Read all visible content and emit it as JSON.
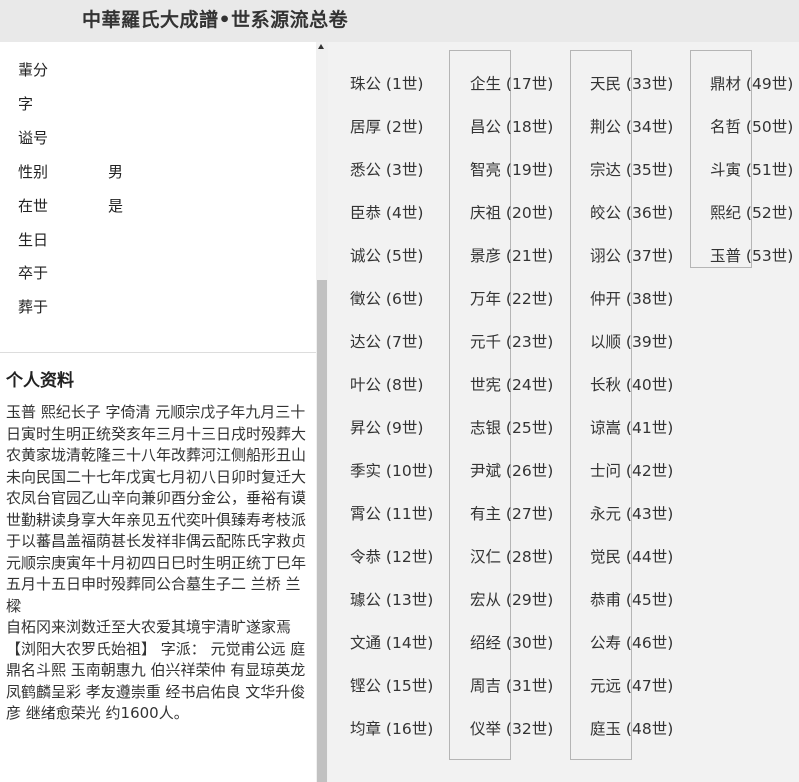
{
  "header": {
    "title": "中華羅氏大成譜•世系源流总卷"
  },
  "info_fields": [
    {
      "label": "輩分",
      "value": ""
    },
    {
      "label": "字",
      "value": ""
    },
    {
      "label": "谥号",
      "value": ""
    },
    {
      "label": "性别",
      "value": "男"
    },
    {
      "label": "在世",
      "value": "是"
    },
    {
      "label": "生日",
      "value": ""
    },
    {
      "label": "卒于",
      "value": ""
    },
    {
      "label": "葬于",
      "value": ""
    }
  ],
  "profile": {
    "title": "个人资料",
    "bio": [
      "玉普 熙纪长子 字倚清 元顺宗戊子年九月三十日寅时生明正统癸亥年三月十三日戌时殁葬大农黄家垅清乾隆三十八年改葬河江侧船形丑山未向民国二十七年戊寅七月初八日卯时复迁大农凤台官园乙山辛向兼卯酉分金公，垂裕有谟世勤耕读身享大年亲见五代奕叶俱臻寿考枝派于以蕃昌盖福荫甚长发祥非偶云配陈氏字救贞元顺宗庚寅年十月初四日巳时生明正统丁巳年五月十五日申时殁葬同公合墓生子二 兰桥 兰樑",
      "自柘冈来浏数迁至大农爱其境宇清旷遂家焉",
      "【浏阳大农罗氏始祖】 字派： 元觉甫公远 庭鼎名斗熙 玉南朝惠九 伯兴祥荣仲 有显琼英龙 凤鹤麟呈彩 孝友遵崇重 经书启佑良 文华升俊彦 继绪愈荣光 约1600人。"
    ]
  },
  "generations": [
    [
      "珠公 (1世)",
      "居厚 (2世)",
      "悉公 (3世)",
      "臣恭 (4世)",
      "诚公 (5世)",
      "徵公 (6世)",
      "达公 (7世)",
      "叶公 (8世)",
      "昇公 (9世)",
      "季实 (10世)",
      "霄公 (11世)",
      "令恭 (12世)",
      "璩公 (13世)",
      "文通 (14世)",
      "铿公 (15世)",
      "均章 (16世)"
    ],
    [
      "企生 (17世)",
      "昌公 (18世)",
      "智亮 (19世)",
      "庆祖 (20世)",
      "景彦 (21世)",
      "万年 (22世)",
      "元千 (23世)",
      "世宪 (24世)",
      "志银 (25世)",
      "尹斌 (26世)",
      "有主 (27世)",
      "汉仁 (28世)",
      "宏从 (29世)",
      "绍经 (30世)",
      "周吉 (31世)",
      "仪举 (32世)"
    ],
    [
      "天民 (33世)",
      "荆公 (34世)",
      "宗达 (35世)",
      "皎公 (36世)",
      "诩公 (37世)",
      "仲开 (38世)",
      "以顺 (39世)",
      "长秋 (40世)",
      "谅嵩 (41世)",
      "士问 (42世)",
      "永元 (43世)",
      "觉民 (44世)",
      "恭甫 (45世)",
      "公寿 (46世)",
      "元远 (47世)",
      "庭玉 (48世)"
    ],
    [
      "鼎材 (49世)",
      "名哲 (50世)",
      "斗寅 (51世)",
      "熙纪 (52世)",
      "玉普 (53世)"
    ]
  ]
}
